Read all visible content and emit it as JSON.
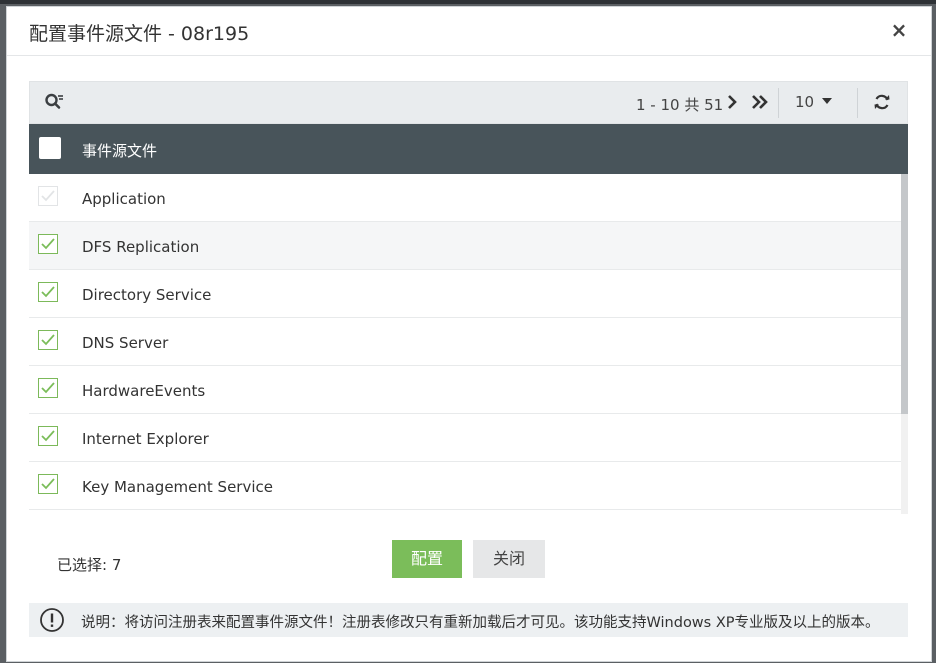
{
  "modal": {
    "title": "配置事件源文件 - 08r195",
    "close_symbol": "×"
  },
  "toolbar": {
    "pager_info": "1 - 10 共 51",
    "page_size": "10"
  },
  "table": {
    "column_header": "事件源文件",
    "rows": [
      {
        "label": "Application",
        "checked": true,
        "disabled": true
      },
      {
        "label": "DFS Replication",
        "checked": true,
        "disabled": false
      },
      {
        "label": "Directory Service",
        "checked": true,
        "disabled": false
      },
      {
        "label": "DNS Server",
        "checked": true,
        "disabled": false
      },
      {
        "label": "HardwareEvents",
        "checked": true,
        "disabled": false
      },
      {
        "label": "Internet Explorer",
        "checked": true,
        "disabled": false
      },
      {
        "label": "Key Management Service",
        "checked": true,
        "disabled": false
      }
    ]
  },
  "footer": {
    "selected_label": "已选择: 7",
    "configure_label": "配置",
    "close_label": "关闭"
  },
  "note": {
    "text": "说明：将访问注册表来配置事件源文件！注册表修改只有重新加载后才可见。该功能支持Windows XP专业版及以上的版本。"
  },
  "colors": {
    "accent_green": "#7bbd5a",
    "header_dark": "#48545a"
  }
}
